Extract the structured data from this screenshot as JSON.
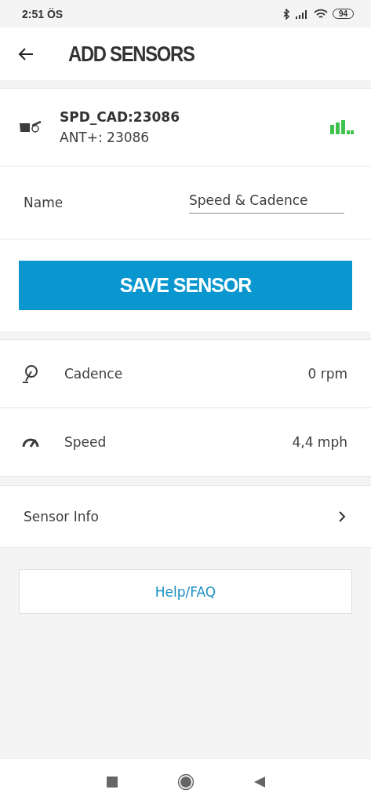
{
  "status_bar": {
    "time": "2:51 ÖS",
    "battery": "94"
  },
  "header": {
    "title": "ADD SENSORS"
  },
  "sensor": {
    "name": "SPD_CAD:23086",
    "id": "ANT+: 23086"
  },
  "name_field": {
    "label": "Name",
    "value": "Speed & Cadence"
  },
  "save_button": "SAVE SENSOR",
  "readings": [
    {
      "kind": "cadence",
      "label": "Cadence",
      "value": "0 rpm"
    },
    {
      "kind": "speed",
      "label": "Speed",
      "value": "4,4 mph"
    }
  ],
  "sensor_info": {
    "label": "Sensor Info"
  },
  "help_button": "Help/FAQ"
}
